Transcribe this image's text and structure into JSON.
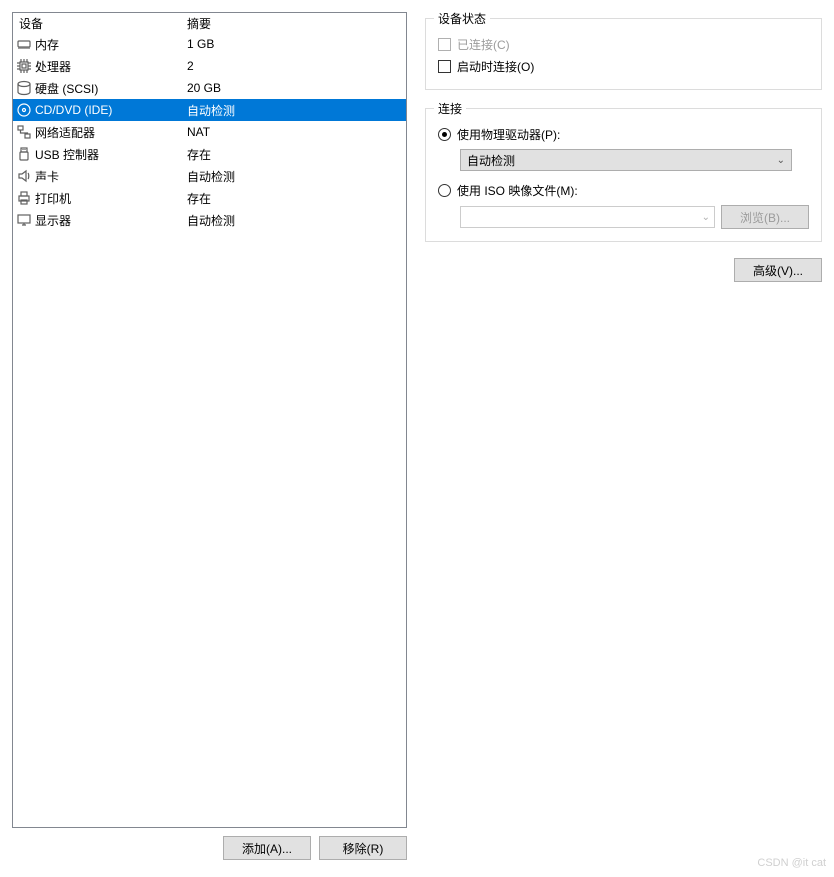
{
  "headers": {
    "device": "设备",
    "summary": "摘要"
  },
  "devices": [
    {
      "icon": "memory",
      "name": "内存",
      "summary": "1 GB",
      "selected": false
    },
    {
      "icon": "cpu",
      "name": "处理器",
      "summary": "2",
      "selected": false
    },
    {
      "icon": "disk",
      "name": "硬盘 (SCSI)",
      "summary": "20 GB",
      "selected": false
    },
    {
      "icon": "cd",
      "name": "CD/DVD (IDE)",
      "summary": "自动检测",
      "selected": true
    },
    {
      "icon": "network",
      "name": "网络适配器",
      "summary": "NAT",
      "selected": false
    },
    {
      "icon": "usb",
      "name": "USB 控制器",
      "summary": "存在",
      "selected": false
    },
    {
      "icon": "sound",
      "name": "声卡",
      "summary": "自动检测",
      "selected": false
    },
    {
      "icon": "printer",
      "name": "打印机",
      "summary": "存在",
      "selected": false
    },
    {
      "icon": "display",
      "name": "显示器",
      "summary": "自动检测",
      "selected": false
    }
  ],
  "buttons": {
    "add": "添加(A)...",
    "remove": "移除(R)",
    "browse": "浏览(B)...",
    "advanced": "高级(V)..."
  },
  "status_group": {
    "title": "设备状态",
    "connected": "已连接(C)",
    "connect_at_start": "启动时连接(O)"
  },
  "connection_group": {
    "title": "连接",
    "use_physical_drive": "使用物理驱动器(P):",
    "physical_drive_value": "自动检测",
    "use_iso": "使用 ISO 映像文件(M):"
  },
  "iso_path": "",
  "watermark": "CSDN @it cat"
}
